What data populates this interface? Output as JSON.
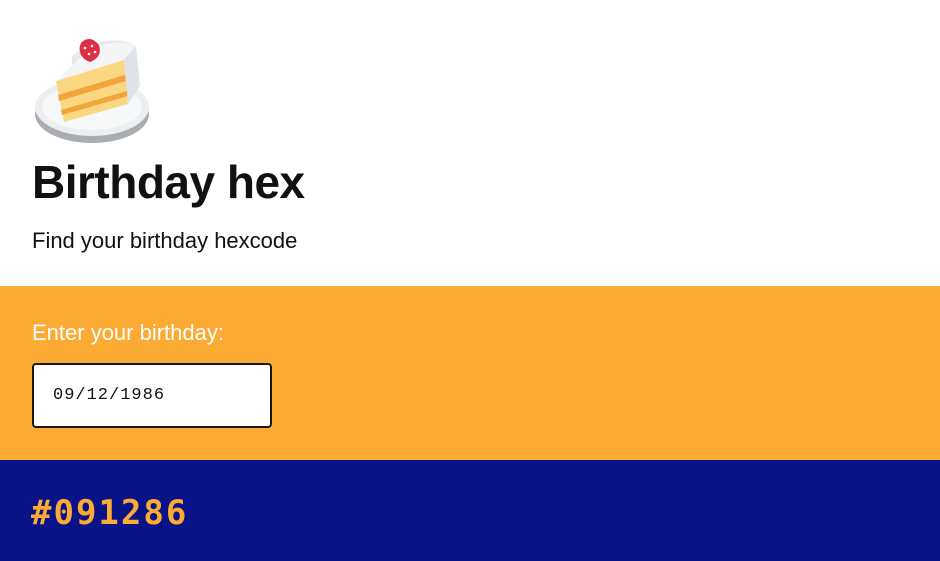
{
  "header": {
    "logo_icon": "birthday-cake-slice-icon",
    "title": "Birthday hex",
    "subtitle": "Find your birthday hexcode"
  },
  "form": {
    "label": "Enter your birthday:",
    "birthday_value": "09/12/1986"
  },
  "result": {
    "hex_code": "#091286"
  },
  "colors": {
    "input_section_bg": "#fbab34",
    "result_section_bg": "#0a1287",
    "hex_text": "#fbab34"
  }
}
